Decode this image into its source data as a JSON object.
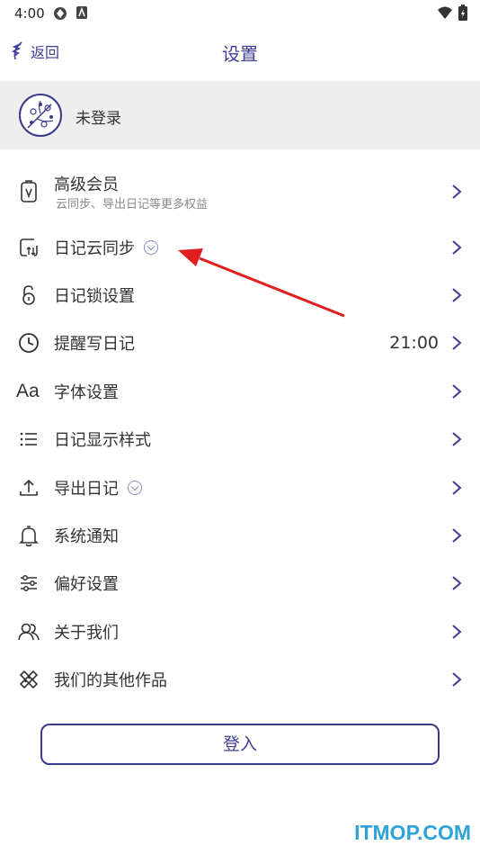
{
  "status_bar": {
    "time": "4:00"
  },
  "header": {
    "back_label": "返回",
    "title": "设置"
  },
  "profile": {
    "name": "未登录"
  },
  "settings": [
    {
      "label": "高级会员",
      "sub": "云同步、导出日记等更多权益",
      "icon": "vip-card-icon"
    },
    {
      "label": "日记云同步",
      "icon": "cloud-sync-icon",
      "premium": true
    },
    {
      "label": "日记锁设置",
      "icon": "lock-icon"
    },
    {
      "label": "提醒写日记",
      "icon": "clock-icon",
      "value": "21:00"
    },
    {
      "label": "字体设置",
      "icon": "font-icon",
      "glyph": "Aa"
    },
    {
      "label": "日记显示样式",
      "icon": "list-icon"
    },
    {
      "label": "导出日记",
      "icon": "export-icon",
      "premium": true
    },
    {
      "label": "系统通知",
      "icon": "bell-icon"
    },
    {
      "label": "偏好设置",
      "icon": "sliders-icon"
    },
    {
      "label": "关于我们",
      "icon": "people-icon"
    },
    {
      "label": "我们的其他作品",
      "icon": "tools-icon"
    }
  ],
  "login_button": "登入",
  "watermark": "ITMOP.COM",
  "colors": {
    "accent": "#3f3f9a",
    "profile_bg": "#eeeeee",
    "annotation_arrow": "#e02020",
    "watermark": "#2fa3d8"
  }
}
